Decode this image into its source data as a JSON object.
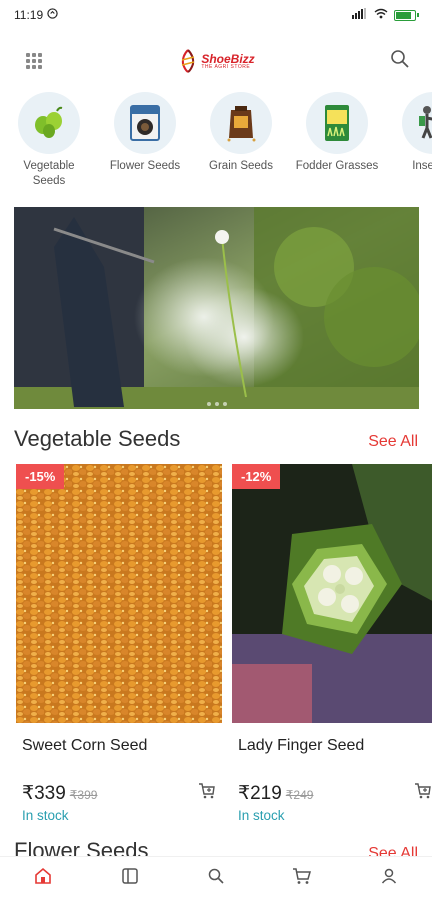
{
  "status_bar": {
    "time": "11:19"
  },
  "header": {
    "logo_name": "ShoeBizz",
    "logo_tagline": "THE AGRI STORE"
  },
  "categories": [
    {
      "label": "Vegetable Seeds",
      "icon": "vegetable-seeds-icon"
    },
    {
      "label": "Flower Seeds",
      "icon": "flower-seeds-packet-icon"
    },
    {
      "label": "Grain Seeds",
      "icon": "grain-seeds-sack-icon"
    },
    {
      "label": "Fodder Grasses",
      "icon": "fodder-grass-packet-icon"
    },
    {
      "label": "Insectici",
      "icon": "sprayer-person-icon"
    }
  ],
  "sections": [
    {
      "title": "Vegetable Seeds",
      "see_all": "See All"
    },
    {
      "title": "Flower Seeds",
      "see_all": "See All"
    }
  ],
  "products": [
    {
      "discount": "-15%",
      "name": "Sweet Corn Seed",
      "price": "₹339",
      "mrp": "₹399",
      "stock": "In stock"
    },
    {
      "discount": "-12%",
      "name": "Lady Finger Seed",
      "price": "₹219",
      "mrp": "₹249",
      "stock": "In stock"
    }
  ],
  "colors": {
    "accent": "#e53935",
    "stock": "#2a9fb0",
    "discount_bg": "#ef4f4f",
    "category_bg": "#e9f1f6"
  },
  "bottom_nav": [
    "home-icon",
    "catalog-icon",
    "search-icon",
    "cart-icon",
    "account-icon"
  ]
}
